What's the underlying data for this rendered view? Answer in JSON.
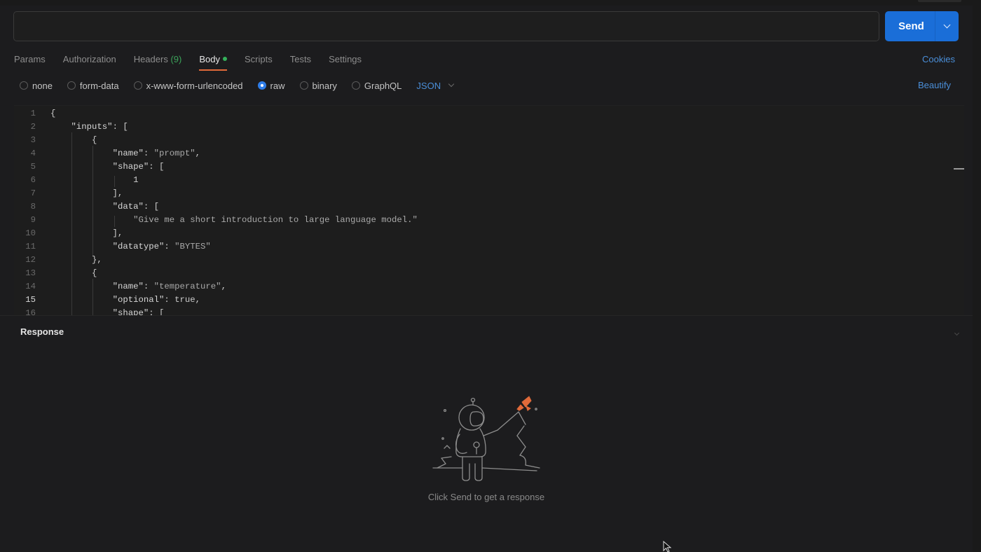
{
  "request": {
    "url_value": "",
    "send_label": "Send"
  },
  "tabs": [
    {
      "label": "Params"
    },
    {
      "label": "Authorization"
    },
    {
      "label": "Headers",
      "count": "(9)"
    },
    {
      "label": "Body"
    },
    {
      "label": "Scripts"
    },
    {
      "label": "Tests"
    },
    {
      "label": "Settings"
    }
  ],
  "cookies_label": "Cookies",
  "body_types": [
    {
      "label": "none",
      "selected": false
    },
    {
      "label": "form-data",
      "selected": false
    },
    {
      "label": "x-www-form-urlencoded",
      "selected": false
    },
    {
      "label": "raw",
      "selected": true
    },
    {
      "label": "binary",
      "selected": false
    },
    {
      "label": "GraphQL",
      "selected": false
    }
  ],
  "language": "JSON",
  "beautify_label": "Beautify",
  "editor": {
    "current_line": 15,
    "lines": [
      {
        "n": "1",
        "text": "{"
      },
      {
        "n": "2",
        "text": "    \"inputs\": ["
      },
      {
        "n": "3",
        "text": "        {"
      },
      {
        "n": "4",
        "text": "            \"name\": \"prompt\","
      },
      {
        "n": "5",
        "text": "            \"shape\": ["
      },
      {
        "n": "6",
        "text": "                1"
      },
      {
        "n": "7",
        "text": "            ],"
      },
      {
        "n": "8",
        "text": "            \"data\": ["
      },
      {
        "n": "9",
        "text": "                \"Give me a short introduction to large language model.\""
      },
      {
        "n": "10",
        "text": "            ],"
      },
      {
        "n": "11",
        "text": "            \"datatype\": \"BYTES\""
      },
      {
        "n": "12",
        "text": "        },"
      },
      {
        "n": "13",
        "text": "        {"
      },
      {
        "n": "14",
        "text": "            \"name\": \"temperature\","
      },
      {
        "n": "15",
        "text": "            \"optional\": true,"
      },
      {
        "n": "16",
        "text": "            \"shape\": ["
      }
    ]
  },
  "response": {
    "label": "Response",
    "empty_text": "Click Send to get a response",
    "illustration": "astronaut-rocket-illustration"
  },
  "colors": {
    "send": "#1a6ed8",
    "active_tab_underline": "#e06a3a",
    "body_dot": "#34b15b",
    "link": "#4a8ed8",
    "rocket": "#e06a3a"
  }
}
